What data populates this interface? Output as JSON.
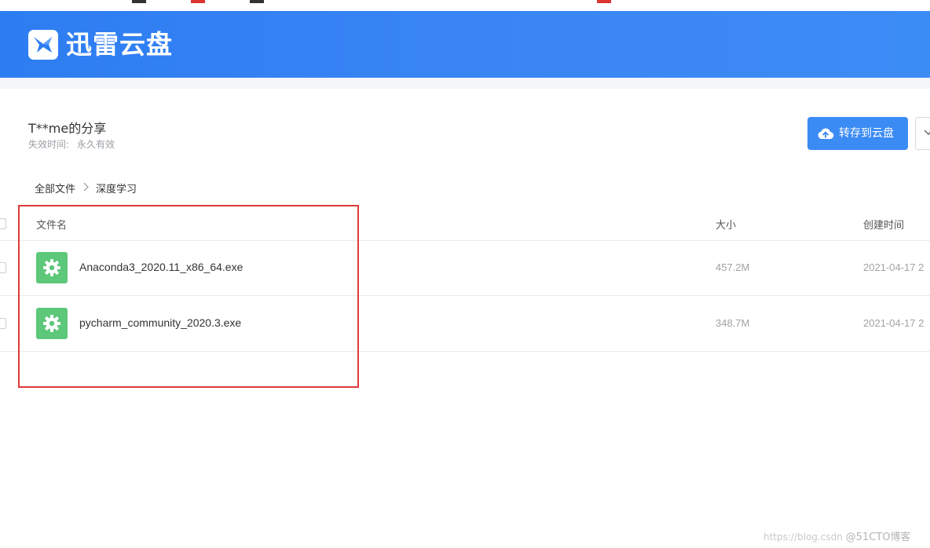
{
  "app": {
    "brand": "迅雷云盘"
  },
  "share": {
    "title": "T**me的分享",
    "expire_label": "失效时间:",
    "expire_value": "永久有效"
  },
  "actions": {
    "save_label": "转存到云盘"
  },
  "breadcrumb": {
    "items": [
      "全部文件",
      "深度学习"
    ]
  },
  "table": {
    "columns": {
      "name": "文件名",
      "size": "大小",
      "created": "创建时间"
    },
    "rows": [
      {
        "name": "Anaconda3_2020.11_x86_64.exe",
        "size": "457.2M",
        "created": "2021-04-17 2",
        "icon": "gear-file-icon"
      },
      {
        "name": "pycharm_community_2020.3.exe",
        "size": "348.7M",
        "created": "2021-04-17 2",
        "icon": "gear-file-icon"
      }
    ]
  },
  "watermark": {
    "url": "https://blog.csdn",
    "site": "@51CTO博客"
  },
  "colors": {
    "header_blue": "#3b86f5",
    "button_blue": "#3b8bf5",
    "file_icon_green": "#5dc77a",
    "highlight_red": "#e0393a"
  }
}
